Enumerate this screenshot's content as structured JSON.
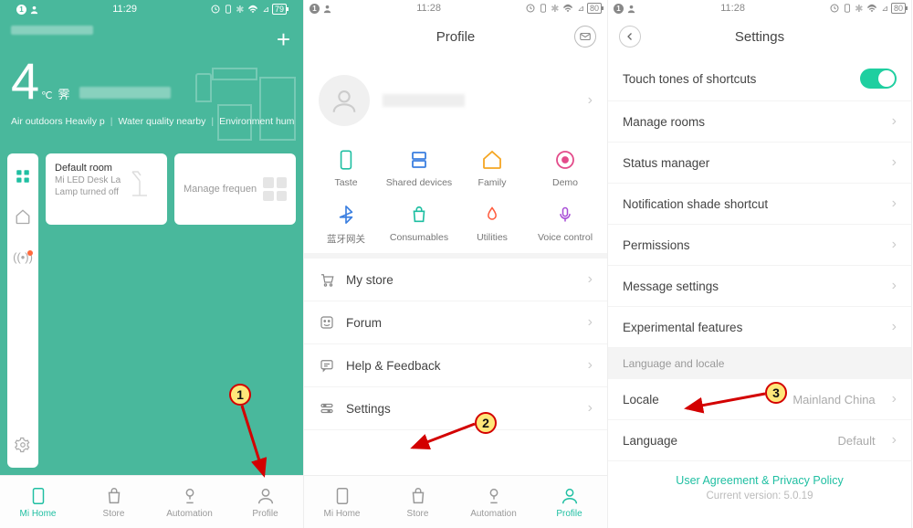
{
  "statusbar": {
    "time": "11:29",
    "time2": "11:28",
    "time3": "11:28",
    "battery": "79",
    "battery2": "80",
    "battery3": "80",
    "notif": "1"
  },
  "s1": {
    "temp": "4",
    "temp_unit": "℃",
    "temp_glyph": "霁",
    "weather": {
      "a": "Air outdoors Heavily p",
      "b": "Water quality nearby",
      "c": "Environment hum"
    },
    "card1": {
      "title": "Default room",
      "sub1": "Mi LED Desk La",
      "sub2": "Lamp turned off"
    },
    "card2": {
      "title": "Manage frequen"
    }
  },
  "nav": {
    "home": "Mi Home",
    "store": "Store",
    "auto": "Automation",
    "profile": "Profile"
  },
  "s2": {
    "title": "Profile",
    "shortcuts": [
      {
        "label": "Taste"
      },
      {
        "label": "Shared devices"
      },
      {
        "label": "Family"
      },
      {
        "label": "Demo"
      },
      {
        "label": "蓝牙网关"
      },
      {
        "label": "Consumables"
      },
      {
        "label": "Utilities"
      },
      {
        "label": "Voice control"
      }
    ],
    "menu": {
      "store": "My store",
      "forum": "Forum",
      "help": "Help & Feedback",
      "settings": "Settings"
    }
  },
  "s3": {
    "title": "Settings",
    "touch_tones": "Touch tones of shortcuts",
    "items": {
      "rooms": "Manage rooms",
      "status": "Status manager",
      "shade": "Notification shade shortcut",
      "perm": "Permissions",
      "msg": "Message settings",
      "exp": "Experimental features"
    },
    "section": "Language and locale",
    "locale": "Locale",
    "locale_val": "Mainland China",
    "lang": "Language",
    "lang_val": "Default",
    "ua": "User Agreement & Privacy Policy",
    "version": "Current version: 5.0.19"
  },
  "anno": {
    "n1": "1",
    "n2": "2",
    "n3": "3"
  }
}
